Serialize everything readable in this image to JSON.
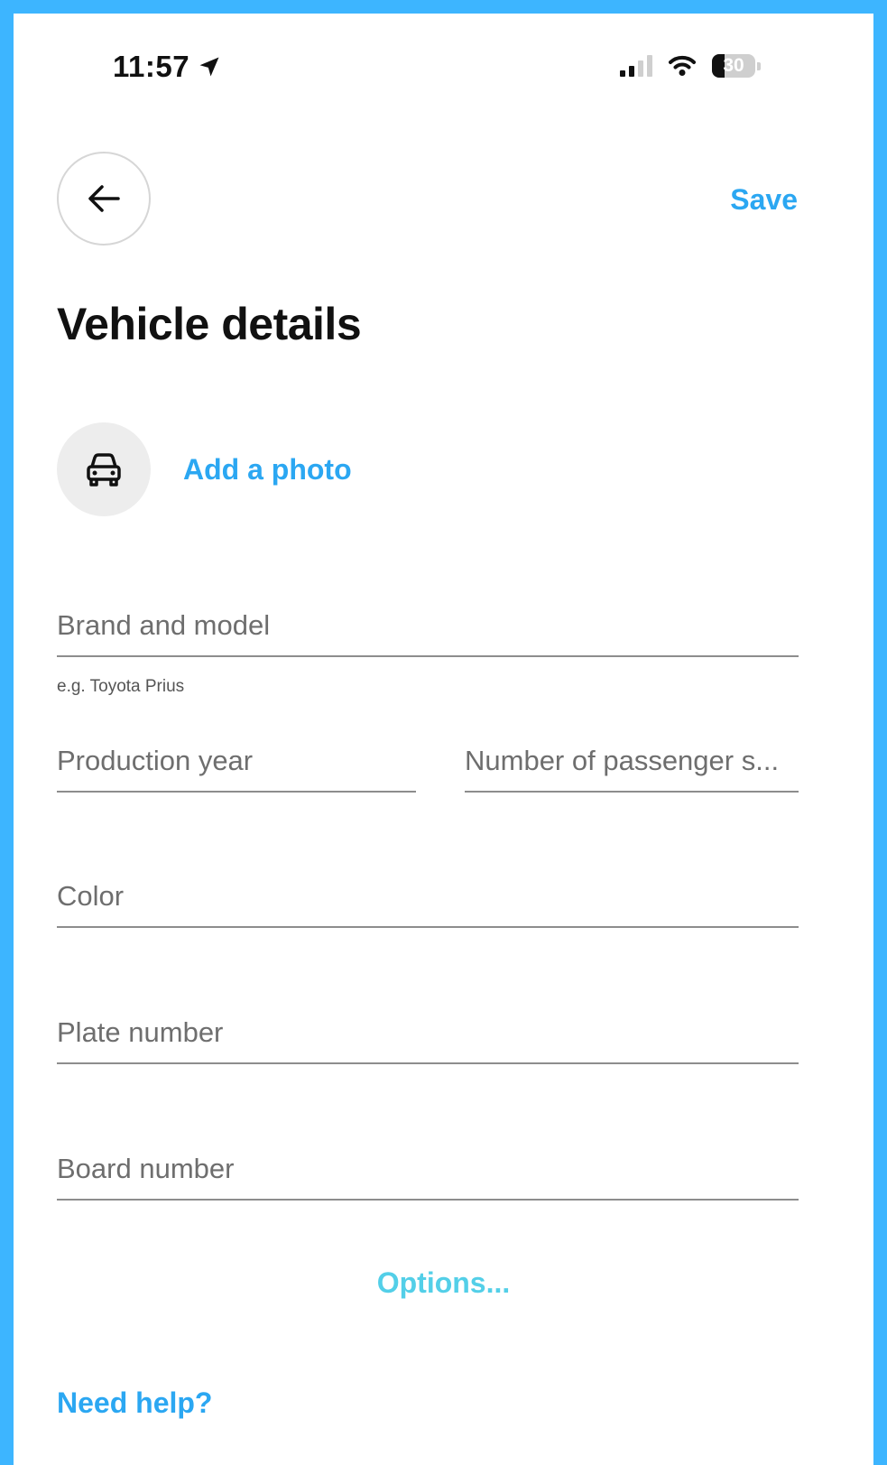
{
  "status_bar": {
    "time": "11:57",
    "battery": "30",
    "battery_level": 0.3
  },
  "header": {
    "save_label": "Save",
    "title": "Vehicle details"
  },
  "photo": {
    "add_label": "Add a photo"
  },
  "form": {
    "brand_model": {
      "placeholder": "Brand and model",
      "value": "",
      "hint": "e.g. Toyota Prius"
    },
    "production_year": {
      "placeholder": "Production year",
      "value": ""
    },
    "passenger_seats": {
      "placeholder": "Number of passenger s...",
      "value": ""
    },
    "color": {
      "placeholder": "Color",
      "value": ""
    },
    "plate_number": {
      "placeholder": "Plate number",
      "value": ""
    },
    "board_number": {
      "placeholder": "Board number",
      "value": ""
    }
  },
  "links": {
    "options": "Options...",
    "help": "Need help?"
  },
  "icons": {
    "back": "arrow-left-icon",
    "location": "location-arrow-icon",
    "signal": "cellular-signal-icon",
    "wifi": "wifi-icon",
    "battery": "battery-icon",
    "car": "car-icon"
  },
  "colors": {
    "frame": "#3db5ff",
    "accent": "#2ba7f2",
    "options": "#53cfe8",
    "text": "#111111",
    "placeholder": "#6e6e6e",
    "underline": "#8d8d8d"
  }
}
